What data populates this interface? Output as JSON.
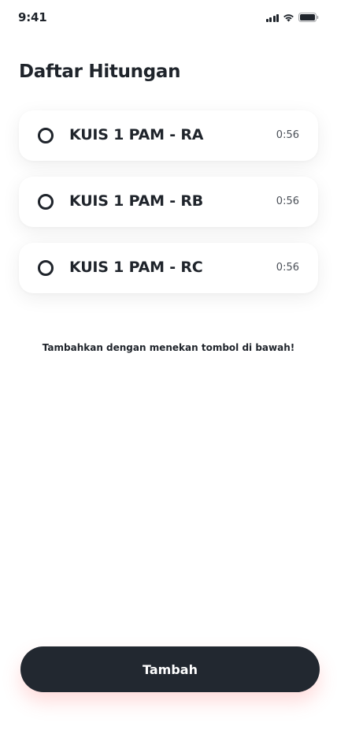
{
  "status_bar": {
    "time": "9:41",
    "icons": [
      "signal-icon",
      "wifi-icon",
      "battery-icon"
    ]
  },
  "header": {
    "title": "Daftar Hitungan"
  },
  "timers": [
    {
      "name": "KUIS 1 PAM - RA",
      "time": "0:56",
      "icon": "radio-icon",
      "selected": false
    },
    {
      "name": "KUIS 1 PAM - RB",
      "time": "0:56",
      "icon": "radio-icon",
      "selected": false
    },
    {
      "name": "KUIS 1 PAM - RC",
      "time": "0:56",
      "icon": "radio-icon",
      "selected": false
    }
  ],
  "hint": "Tambahkan dengan menekan tombol di bawah!",
  "footer": {
    "add_label": "Tambah"
  },
  "colors": {
    "button_bg": "#222830",
    "text": "#1f242b",
    "background": "#ffffff",
    "button_glow": "#ff5a5a"
  }
}
